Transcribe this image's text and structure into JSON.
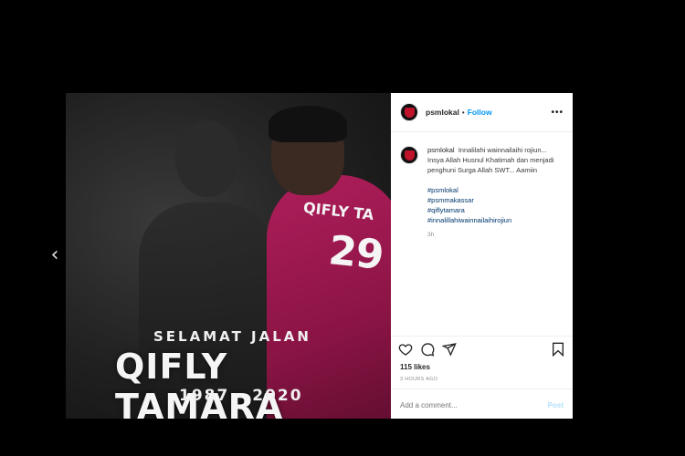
{
  "nav": {
    "prev_glyph": "‹"
  },
  "photo": {
    "jersey_name": "QIFLY TA",
    "jersey_number": "29",
    "tribute_sub": "SELAMAT JALAN",
    "tribute_name": "QIFLY TAMARA",
    "tribute_years": "1987 - 2020"
  },
  "header": {
    "username": "psmlokal",
    "separator": "•",
    "follow_label": "Follow",
    "more_label": "•••"
  },
  "caption": {
    "username": "psmlokal",
    "text": "Innalilahi wainnailaihi rojiun... Insya Allah Husnul Khatimah dan menjadi penghuni Surga Allah SWT... Aamiin",
    "hashtags": [
      "#psmlokal",
      "#psmmakassar",
      "#qiflytamara",
      "#innalillahiwainnailaihirojiun"
    ],
    "time": "3h"
  },
  "stats": {
    "likes": "115 likes",
    "posted": "3 HOURS AGO"
  },
  "comment": {
    "placeholder": "Add a comment...",
    "post_label": "Post"
  },
  "colors": {
    "accent": "#0095f6",
    "hashtag": "#00376b",
    "jersey": "#b01e5b",
    "badge": "#c0132b"
  }
}
